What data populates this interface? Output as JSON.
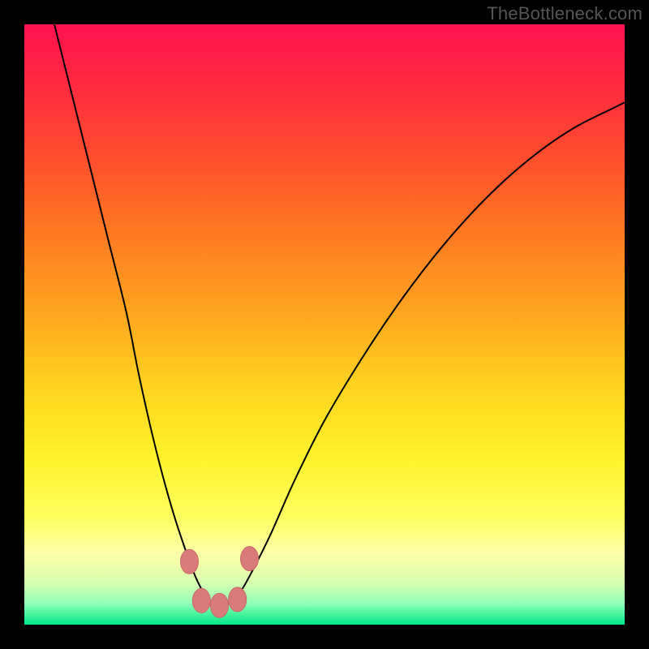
{
  "watermark": "TheBottleneck.com",
  "colors": {
    "black": "#000000",
    "curve": "#000000",
    "marker_fill": "#d97b7b",
    "marker_stroke": "#c96a6a",
    "gradient_stops": [
      {
        "offset": 0.0,
        "color": "#ff1250"
      },
      {
        "offset": 0.1,
        "color": "#ff2a3f"
      },
      {
        "offset": 0.22,
        "color": "#ff4d2d"
      },
      {
        "offset": 0.35,
        "color": "#ff7a22"
      },
      {
        "offset": 0.48,
        "color": "#ffa51f"
      },
      {
        "offset": 0.6,
        "color": "#ffd21f"
      },
      {
        "offset": 0.72,
        "color": "#fff22a"
      },
      {
        "offset": 0.82,
        "color": "#ffff60"
      },
      {
        "offset": 0.88,
        "color": "#ffffa8"
      },
      {
        "offset": 0.93,
        "color": "#d8ffb0"
      },
      {
        "offset": 0.965,
        "color": "#8fffb8"
      },
      {
        "offset": 1.0,
        "color": "#00e887"
      }
    ]
  },
  "chart_data": {
    "type": "line",
    "title": "",
    "xlabel": "",
    "ylabel": "",
    "xlim": [
      0,
      100
    ],
    "ylim": [
      0,
      100
    ],
    "grid": false,
    "legend": false,
    "series": [
      {
        "name": "bottleneck-curve",
        "x": [
          5,
          8,
          11,
          14,
          17,
          19,
          21,
          23,
          25,
          27,
          28.5,
          30,
          31,
          32.5,
          34,
          36,
          38,
          41,
          45,
          50,
          56,
          62,
          68,
          74,
          80,
          86,
          92,
          98,
          100
        ],
        "y": [
          100,
          88,
          76,
          64,
          52,
          42,
          33,
          25,
          18,
          12,
          8,
          5,
          3.5,
          3,
          3.5,
          5.5,
          9,
          15,
          24,
          34,
          44,
          53,
          61,
          68,
          74,
          79,
          83,
          86,
          87
        ]
      }
    ],
    "markers": [
      {
        "x": 27.5,
        "y": 10.5
      },
      {
        "x": 29.5,
        "y": 4.0
      },
      {
        "x": 32.5,
        "y": 3.2
      },
      {
        "x": 35.5,
        "y": 4.2
      },
      {
        "x": 37.5,
        "y": 11.0
      }
    ]
  }
}
